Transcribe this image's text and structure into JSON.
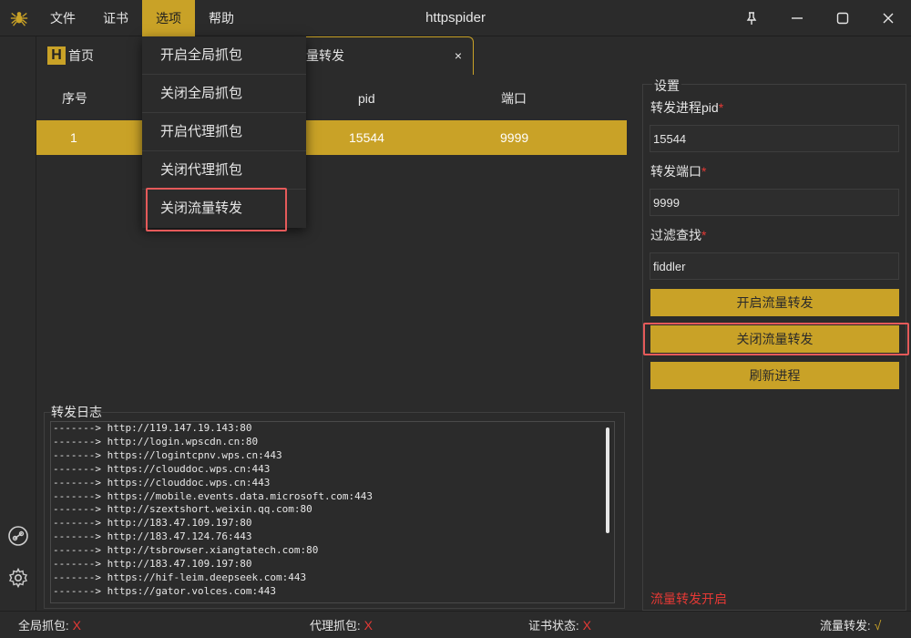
{
  "app": {
    "title": "httpspider",
    "logo_icon": "spider-icon"
  },
  "menu": [
    "文件",
    "证书",
    "选项",
    "帮助"
  ],
  "tabs": {
    "home": "首页",
    "home_icon": "H",
    "forward": "量转发",
    "close": "×"
  },
  "table": {
    "headers": [
      "序号",
      "pid",
      "端口"
    ],
    "rows": [
      {
        "index": "1",
        "pid": "15544",
        "port": "9999"
      }
    ]
  },
  "dropdown": [
    "开启全局抓包",
    "关闭全局抓包",
    "开启代理抓包",
    "关闭代理抓包",
    "关闭流量转发"
  ],
  "log": {
    "title": "转发日志",
    "lines": [
      "-------> http://119.147.19.143:80",
      "-------> http://login.wpscdn.cn:80",
      "-------> https://logintcpnv.wps.cn:443",
      "-------> https://clouddoc.wps.cn:443",
      "-------> https://clouddoc.wps.cn:443",
      "-------> https://mobile.events.data.microsoft.com:443",
      "-------> http://szextshort.weixin.qq.com:80",
      "-------> http://183.47.109.197:80",
      "-------> http://183.47.124.76:443",
      "-------> http://tsbrowser.xiangtatech.com:80",
      "-------> http://183.47.109.197:80",
      "-------> https://hif-leim.deepseek.com:443",
      "-------> https://gator.volces.com:443"
    ]
  },
  "settings": {
    "title": "设置",
    "pid_label": "转发进程pid",
    "pid_value": "15544",
    "port_label": "转发端口",
    "port_value": "9999",
    "filter_label": "过滤查找",
    "filter_value": "fiddler",
    "required_mark": "*",
    "btn_start": "开启流量转发",
    "btn_stop": "关闭流量转发",
    "btn_refresh": "刷新进程",
    "status": "流量转发开启"
  },
  "statusbar": {
    "global": "全局抓包:",
    "global_state": "X",
    "proxy": "代理抓包:",
    "proxy_state": "X",
    "cert": "证书状态:",
    "cert_state": "X",
    "forward": "流量转发:",
    "forward_state": "√"
  },
  "colors": {
    "accent": "#c9a227",
    "background": "#2b2b2b",
    "error": "#e53935",
    "highlight": "#e55a5a"
  }
}
